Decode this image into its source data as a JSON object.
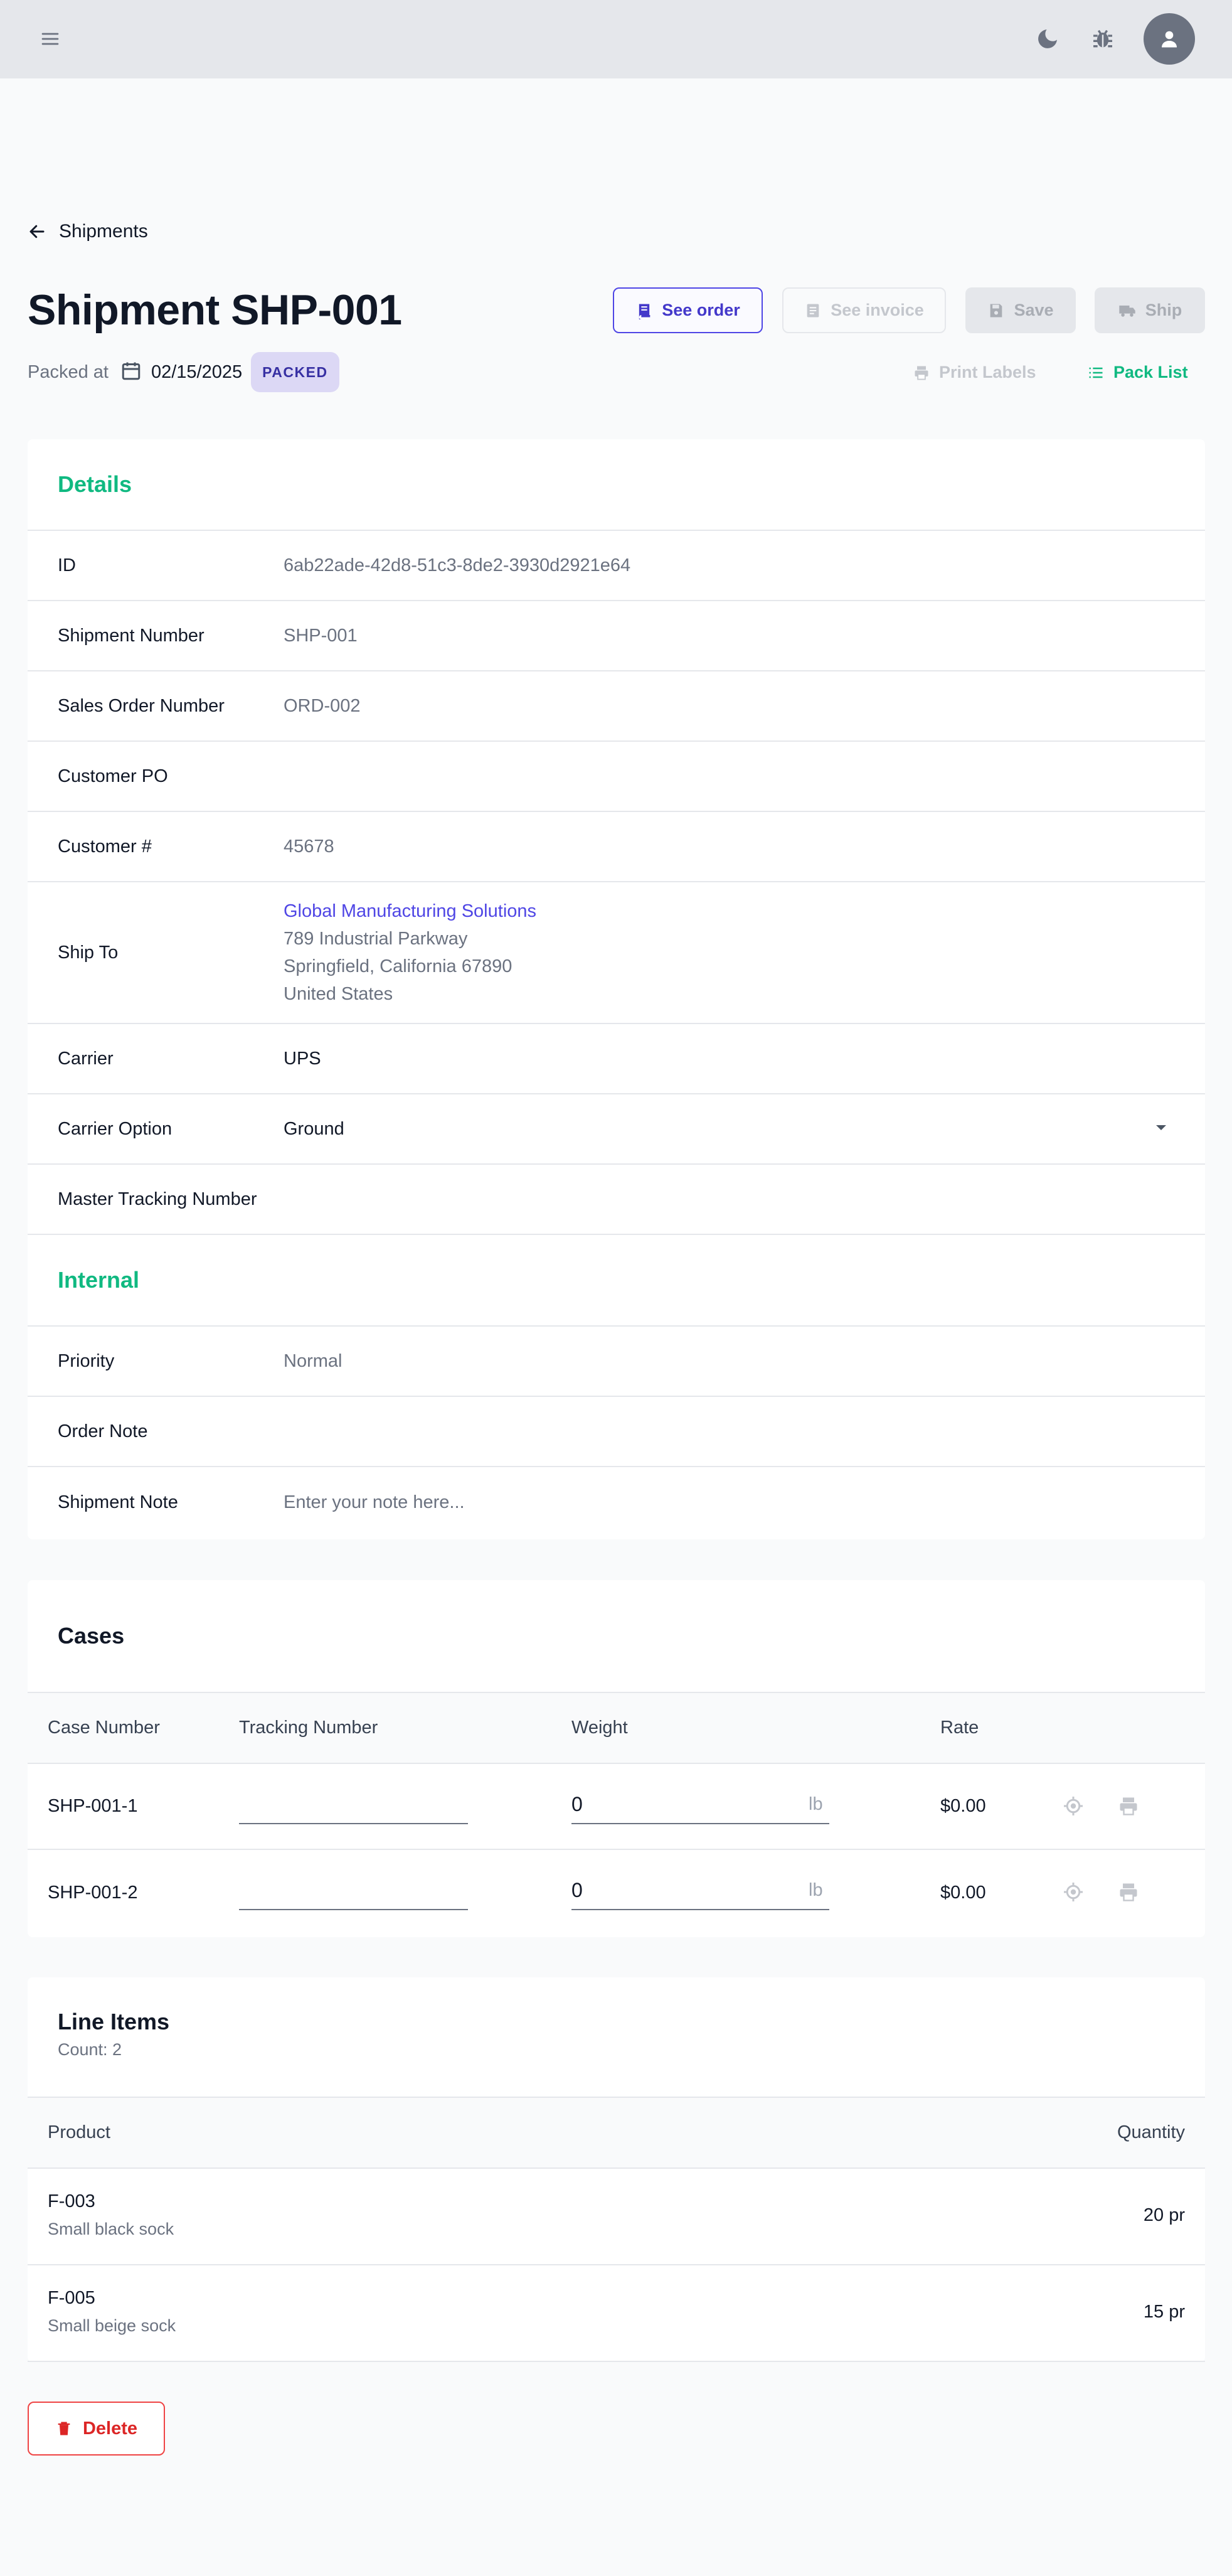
{
  "topbar": {
    "menu_icon": "hamburger-icon",
    "theme_icon": "moon-icon",
    "debug_icon": "bug-icon",
    "avatar_icon": "user-icon"
  },
  "nav": {
    "back_label": "Shipments"
  },
  "header": {
    "title": "Shipment SHP-001",
    "packed_label": "Packed at",
    "packed_date": "02/15/2025",
    "status_badge": "PACKED",
    "buttons": {
      "see_order": "See order",
      "see_invoice": "See invoice",
      "save": "Save",
      "ship": "Ship"
    },
    "links": {
      "print_labels": "Print Labels",
      "pack_list": "Pack List"
    }
  },
  "details": {
    "heading": "Details",
    "rows": [
      {
        "label": "ID",
        "value": "6ab22ade-42d8-51c3-8de2-3930d2921e64"
      },
      {
        "label": "Shipment Number",
        "value": "SHP-001"
      },
      {
        "label": "Sales Order Number",
        "value": "ORD-002"
      },
      {
        "label": "Customer PO",
        "value": ""
      },
      {
        "label": "Customer #",
        "value": "45678"
      }
    ],
    "ship_to": {
      "label": "Ship To",
      "name": "Global Manufacturing Solutions",
      "street": "789 Industrial Parkway",
      "city_state_zip": "Springfield, California 67890",
      "country": "United States"
    },
    "carrier": {
      "label": "Carrier",
      "value": "UPS"
    },
    "carrier_option": {
      "label": "Carrier Option",
      "value": "Ground"
    },
    "master_tracking": {
      "label": "Master Tracking Number",
      "value": ""
    }
  },
  "internal": {
    "heading": "Internal",
    "priority": {
      "label": "Priority",
      "value": "Normal"
    },
    "order_note": {
      "label": "Order Note",
      "value": ""
    },
    "shipment_note": {
      "label": "Shipment Note",
      "placeholder": "Enter your note here..."
    }
  },
  "cases": {
    "heading": "Cases",
    "columns": [
      "Case Number",
      "Tracking Number",
      "Weight",
      "Rate"
    ],
    "rows": [
      {
        "case_number": "SHP-001-1",
        "tracking": "",
        "weight": "0",
        "unit": "lb",
        "rate": "$0.00"
      },
      {
        "case_number": "SHP-001-2",
        "tracking": "",
        "weight": "0",
        "unit": "lb",
        "rate": "$0.00"
      }
    ]
  },
  "line_items": {
    "heading": "Line Items",
    "count_label": "Count: 2",
    "columns": [
      "Product",
      "Quantity"
    ],
    "rows": [
      {
        "code": "F-003",
        "description": "Small black sock",
        "quantity": "20 pr"
      },
      {
        "code": "F-005",
        "description": "Small beige sock",
        "quantity": "15 pr"
      }
    ]
  },
  "footer": {
    "delete_label": "Delete"
  },
  "colors": {
    "accent": "#10b981",
    "primary": "#4f46e5",
    "danger": "#dc2626",
    "badge_bg": "#dcd8f5"
  }
}
